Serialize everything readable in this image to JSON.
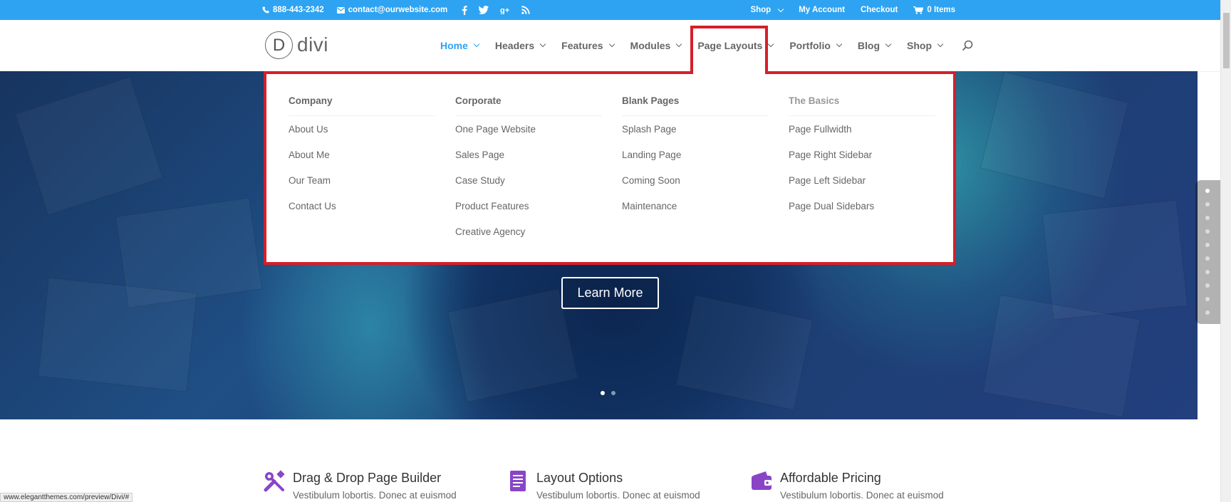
{
  "topbar": {
    "phone": "888-443-2342",
    "email": "contact@ourwebsite.com",
    "links": [
      "Shop",
      "My Account",
      "Checkout"
    ],
    "cart": "0 Items"
  },
  "header": {
    "logo_mark": "D",
    "logo_text": "divi",
    "nav": [
      {
        "label": "Home"
      },
      {
        "label": "Headers"
      },
      {
        "label": "Features"
      },
      {
        "label": "Modules"
      },
      {
        "label": "Page Layouts"
      },
      {
        "label": "Portfolio"
      },
      {
        "label": "Blog"
      },
      {
        "label": "Shop"
      }
    ]
  },
  "mega_menu": {
    "columns": [
      {
        "heading": "Company",
        "items": [
          "About Us",
          "About Me",
          "Our Team",
          "Contact Us"
        ]
      },
      {
        "heading": "Corporate",
        "items": [
          "One Page Website",
          "Sales Page",
          "Case Study",
          "Product Features",
          "Creative Agency"
        ]
      },
      {
        "heading": "Blank Pages",
        "items": [
          "Splash Page",
          "Landing Page",
          "Coming Soon",
          "Maintenance"
        ]
      },
      {
        "heading": "The Basics",
        "items": [
          "Page Fullwidth",
          "Page Right Sidebar",
          "Page Left Sidebar",
          "Page Dual Sidebars"
        ]
      }
    ]
  },
  "hero": {
    "button": "Learn More"
  },
  "features": [
    {
      "title": "Drag & Drop Page Builder",
      "desc": "Vestibulum lobortis. Donec at euismod",
      "icon": "wrench-screwdriver-icon"
    },
    {
      "title": "Layout Options",
      "desc": "Vestibulum lobortis. Donec at euismod",
      "icon": "document-icon"
    },
    {
      "title": "Affordable Pricing",
      "desc": "Vestibulum lobortis. Donec at euismod",
      "icon": "wallet-icon"
    }
  ],
  "statusbar": {
    "url": "www.elegantthemes.com/preview/Divi/#"
  },
  "colors": {
    "accent": "#2ea3f2",
    "highlight": "#d51f2a",
    "icon_purple": "#8a45c7"
  }
}
